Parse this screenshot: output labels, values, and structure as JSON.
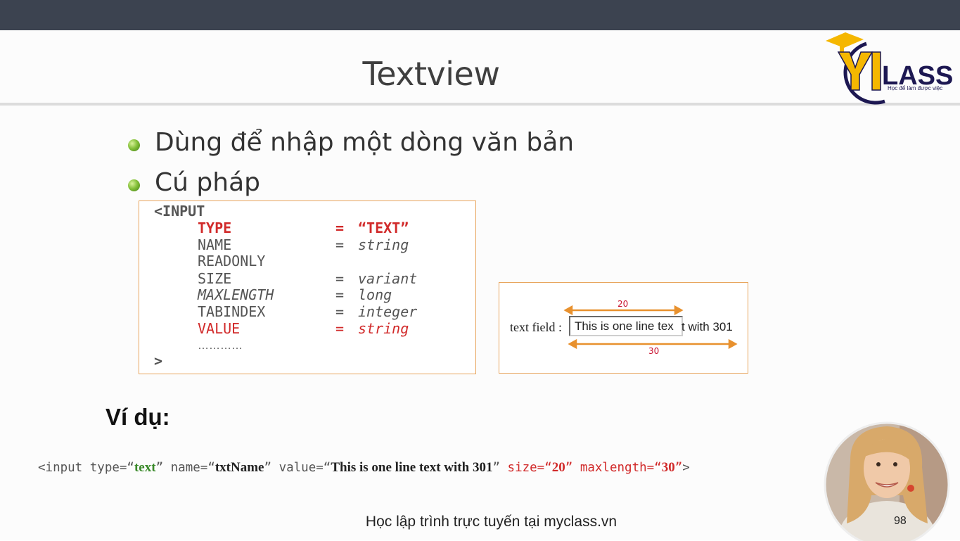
{
  "slide": {
    "title": "Textview",
    "bullets": [
      "Dùng để nhập một dòng văn bản",
      "Cú pháp"
    ],
    "logo": {
      "text": "LASS",
      "tagline": "Học để làm được việc",
      "accent": "#f5b700",
      "brand": "#1d1852"
    }
  },
  "syntax": {
    "open": "<INPUT",
    "close": ">",
    "rows": [
      {
        "attr": "TYPE",
        "eq": "=",
        "value": "“TEXT”"
      },
      {
        "attr": "NAME",
        "eq": "=",
        "value": "string"
      },
      {
        "attr": "READONLY",
        "eq": "",
        "value": ""
      },
      {
        "attr": "SIZE",
        "eq": "=",
        "value": "variant"
      },
      {
        "attr": "MAXLENGTH",
        "eq": "=",
        "value": "long"
      },
      {
        "attr": "TABINDEX",
        "eq": "=",
        "value": "integer"
      },
      {
        "attr": "VALUE",
        "eq": "=",
        "value": "string"
      },
      {
        "attr": "…………",
        "eq": "",
        "value": ""
      }
    ]
  },
  "demo": {
    "label": "text field :",
    "visible_text": "This is one line tex",
    "overflow_text": "t with 301",
    "size_label": "20",
    "maxlength_label": "30"
  },
  "example": {
    "heading": "Ví dụ:",
    "p1": "<input type=“",
    "type_value": "text",
    "p2": "” name=“",
    "name_value": "txtName",
    "p3": "” value=“",
    "value_value": "This is one line text with 301",
    "p4": "” ",
    "p5": "size=“",
    "size_value": "20",
    "p6": "” maxlength=“",
    "maxlength_value": "30",
    "p7": "”",
    "p8": ">"
  },
  "footer": {
    "text": "Học lập trình trực tuyến tại myclass.vn",
    "page_number": "98"
  },
  "colors": {
    "topbar": "#3c4350",
    "box_border": "#e8a55d",
    "red": "#d12a2a",
    "green": "#3a8a2a",
    "dimension_arrow": "#e8912e"
  }
}
